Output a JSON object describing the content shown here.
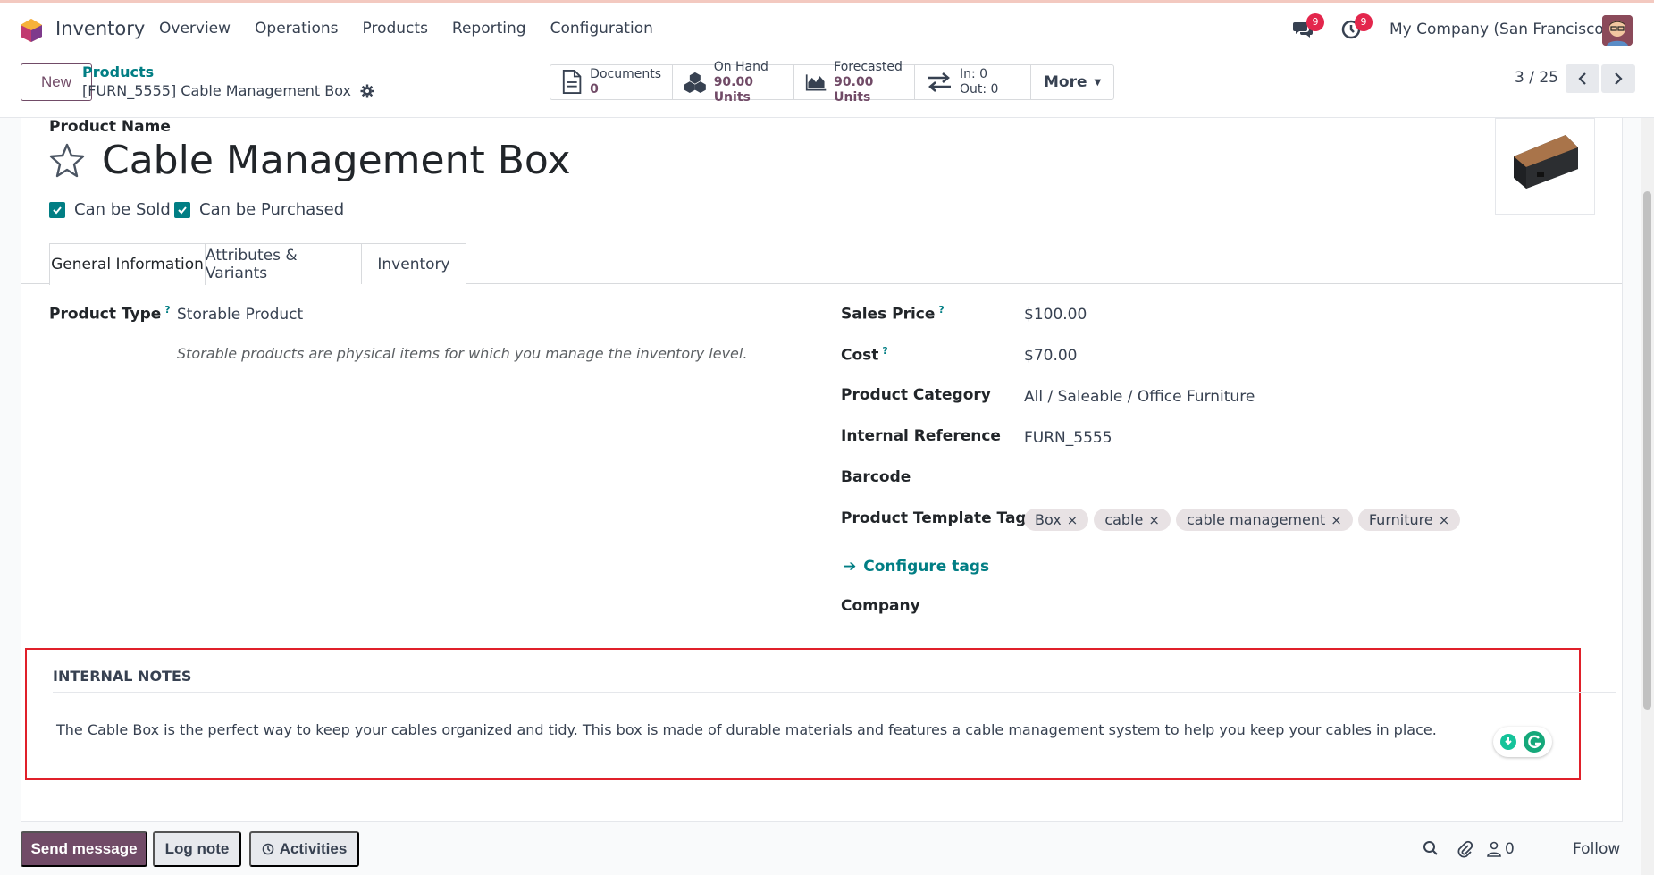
{
  "navbar": {
    "app_title": "Inventory",
    "menu": [
      "Overview",
      "Operations",
      "Products",
      "Reporting",
      "Configuration"
    ],
    "messages_badge": "9",
    "activities_badge": "9",
    "company": "My Company (San Francisco)"
  },
  "control": {
    "new_label": "New",
    "breadcrumb_parent": "Products",
    "breadcrumb_current": "[FURN_5555] Cable Management Box",
    "stats": {
      "documents_label": "Documents",
      "documents_value": "0",
      "onhand_label": "On Hand",
      "onhand_value": "90.00 Units",
      "forecasted_label": "Forecasted",
      "forecasted_value": "90.00 Units",
      "in_label": "In: 0",
      "out_label": "Out: 0",
      "more_label": "More"
    },
    "pager": "3 / 25"
  },
  "product": {
    "name_label": "Product Name",
    "name": "Cable Management Box",
    "can_be_sold": "Can be Sold",
    "can_be_purchased": "Can be Purchased"
  },
  "tabs": [
    "General Information",
    "Attributes & Variants",
    "Inventory"
  ],
  "general": {
    "product_type_label": "Product Type",
    "product_type_value": "Storable Product",
    "product_type_hint": "Storable products are physical items for which you manage the inventory level.",
    "sales_price_label": "Sales Price",
    "sales_price_value": "$100.00",
    "cost_label": "Cost",
    "cost_value": "$70.00",
    "category_label": "Product Category",
    "category_value": "All / Saleable / Office Furniture",
    "internal_ref_label": "Internal Reference",
    "internal_ref_value": "FURN_5555",
    "barcode_label": "Barcode",
    "tags_label": "Product Template Tags",
    "tags": [
      "Box",
      "cable",
      "cable management",
      "Furniture"
    ],
    "configure_tags": "Configure tags",
    "company_label": "Company"
  },
  "notes": {
    "title": "INTERNAL NOTES",
    "text": "The Cable Box is the perfect way to keep your cables organized and tidy. This box is made of durable materials and features a cable management system to help you keep your cables in place."
  },
  "chatter": {
    "send_message": "Send message",
    "log_note": "Log note",
    "activities": "Activities",
    "followers_count": "0",
    "follow": "Follow"
  },
  "colors": {
    "brand": "#714b67",
    "accent": "#017e84",
    "highlight_border": "#e0202a"
  }
}
